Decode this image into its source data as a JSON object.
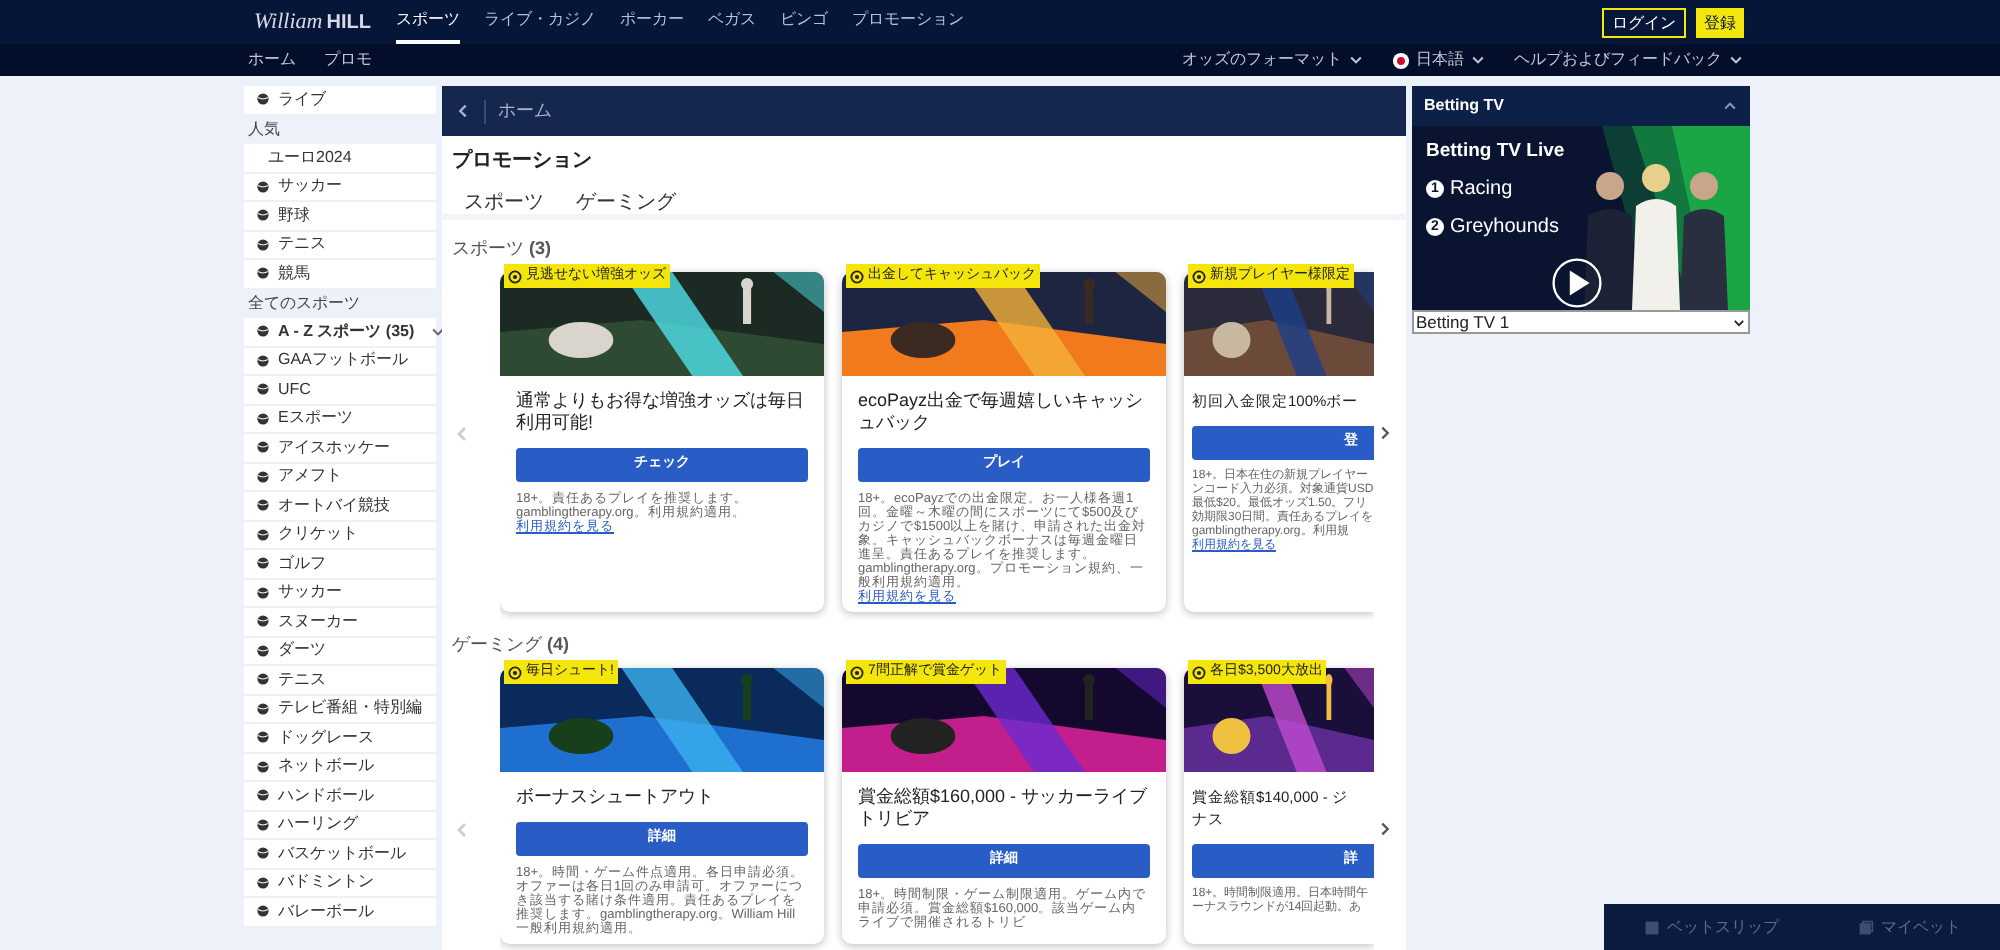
{
  "top_nav": {
    "logo_script": "William",
    "logo_bold": "HILL",
    "items": [
      {
        "label": "スポーツ",
        "selected": true
      },
      {
        "label": "ライブ・カジノ",
        "selected": false
      },
      {
        "label": "ポーカー",
        "selected": false
      },
      {
        "label": "ベガス",
        "selected": false
      },
      {
        "label": "ビンゴ",
        "selected": false
      },
      {
        "label": "プロモーション",
        "selected": false
      }
    ],
    "login": "ログイン",
    "register": "登録"
  },
  "sub_nav": {
    "links": [
      "ホーム",
      "プロモ"
    ],
    "menus": [
      {
        "kind": "plain",
        "label": "オッズのフォーマット"
      },
      {
        "kind": "language",
        "label": "日本語"
      },
      {
        "kind": "plain",
        "label": "ヘルプおよびフィードバック"
      }
    ]
  },
  "sidebar": {
    "items": [
      {
        "kind": "item",
        "label": "ライブ"
      },
      {
        "kind": "heading",
        "label": "人気"
      },
      {
        "kind": "plain",
        "label": "ユーロ2024"
      },
      {
        "kind": "item",
        "label": "サッカー"
      },
      {
        "kind": "item",
        "label": "野球"
      },
      {
        "kind": "item",
        "label": "テニス"
      },
      {
        "kind": "item",
        "label": "競馬"
      },
      {
        "kind": "heading",
        "label": "全てのスポーツ"
      },
      {
        "kind": "group",
        "label": "A - Z スポーツ (35)",
        "expanded": true
      },
      {
        "kind": "item",
        "label": "GAAフットボール"
      },
      {
        "kind": "item",
        "label": "UFC"
      },
      {
        "kind": "item",
        "label": "Eスポーツ"
      },
      {
        "kind": "item",
        "label": "アイスホッケー"
      },
      {
        "kind": "item",
        "label": "アメフト"
      },
      {
        "kind": "item",
        "label": "オートバイ競技"
      },
      {
        "kind": "item",
        "label": "クリケット"
      },
      {
        "kind": "item",
        "label": "ゴルフ"
      },
      {
        "kind": "item",
        "label": "サッカー"
      },
      {
        "kind": "item",
        "label": "スヌーカー"
      },
      {
        "kind": "item",
        "label": "ダーツ"
      },
      {
        "kind": "item",
        "label": "テニス"
      },
      {
        "kind": "item",
        "label": "テレビ番組・特別編"
      },
      {
        "kind": "item",
        "label": "ドッグレース"
      },
      {
        "kind": "item",
        "label": "ネットボール"
      },
      {
        "kind": "item",
        "label": "ハンドボール"
      },
      {
        "kind": "item",
        "label": "ハーリング"
      },
      {
        "kind": "item",
        "label": "バスケットボール"
      },
      {
        "kind": "item",
        "label": "バドミントン"
      },
      {
        "kind": "item",
        "label": "バレーボール"
      }
    ]
  },
  "main": {
    "breadcrumb": "ホーム",
    "title": "プロモーション",
    "tabs": [
      {
        "label": "スポーツ",
        "selected": false
      },
      {
        "label": "ゲーミング",
        "selected": false
      }
    ],
    "sections": [
      {
        "heading": "スポーツ **(3)**",
        "cards": [
          {
            "tag": "見逃せない増強オッズ",
            "title": "通常よりもお得な増強オッズは毎日利用可能!",
            "button": "チェック",
            "terms": "18+。責任あるプレイを推奨します。gamblingtherapy.org。利用規約適用。",
            "link": "利用規約を見る"
          },
          {
            "tag": "出金してキャッシュバック",
            "title": "ecoPayz出金で毎週嬉しいキャッシュバック",
            "button": "プレイ",
            "terms": "18+。ecoPayzでの出金限定。お一人様各週1回。金曜～木曜の間にスポーツにて$500及びカジノで$1500以上を賭け、申請された出金対象。キャッシュバックボーナスは毎週金曜日進呈。責任あるプレイを推奨します。gamblingtherapy.org。プロモーション規約、一般利用規約適用。",
            "link": "利用規約を見る"
          },
          {
            "tag": "新規プレイヤー様限定",
            "title_lines": [
              "初回入金限定100%ボー"
            ],
            "button": "登",
            "terms_lines": [
              "18+。日本在住の新規プレイヤー",
              "ンコード入力必須。対象通貨USD",
              "最低$20。最低オッズ1.50。フリ",
              "効期限30日間。責任あるプレイを",
              "gamblingtherapy.org。利用規"
            ],
            "link": "利用規約を見る"
          }
        ]
      },
      {
        "heading": "ゲーミング **(4)**",
        "cards": [
          {
            "tag": "毎日シュート!",
            "title": "ボーナスシュートアウト",
            "button": "詳細",
            "terms": "18+。時間・ゲーム件点適用。各日申請必須。オファーは各日1回のみ申請可。オファーにつき該当する賭け条件適用。責任あるプレイを推奨します。gamblingtherapy.org。William Hill 一般利用規約適用。"
          },
          {
            "tag": "7問正解で賞金ゲット",
            "title": "賞金総額$160,000 - サッカーライブトリビア",
            "button": "詳細",
            "terms": "18+。時間制限・ゲーム制限適用。ゲーム内で申請必須。賞金総額$160,000。該当ゲーム内ライブで開催されるトリビ"
          },
          {
            "tag": "各日$3,500大放出",
            "title_lines": [
              "賞金総額$140,000 - ジ",
              "ナス"
            ],
            "button": "詳",
            "terms_lines": [
              "18+。時間制限適用。日本時間午",
              "ーナスラウンドが14回起動。あ"
            ]
          }
        ]
      }
    ]
  },
  "betting_tv": {
    "title": "Betting TV",
    "expanded": true,
    "banner": {
      "headline": "Betting TV Live",
      "lines": [
        {
          "number": "1",
          "label": "Racing"
        },
        {
          "number": "2",
          "label": "Greyhounds"
        }
      ]
    },
    "channel": "Betting TV 1"
  },
  "bottom_bar": [
    "ベットスリップ",
    "マイベット"
  ]
}
